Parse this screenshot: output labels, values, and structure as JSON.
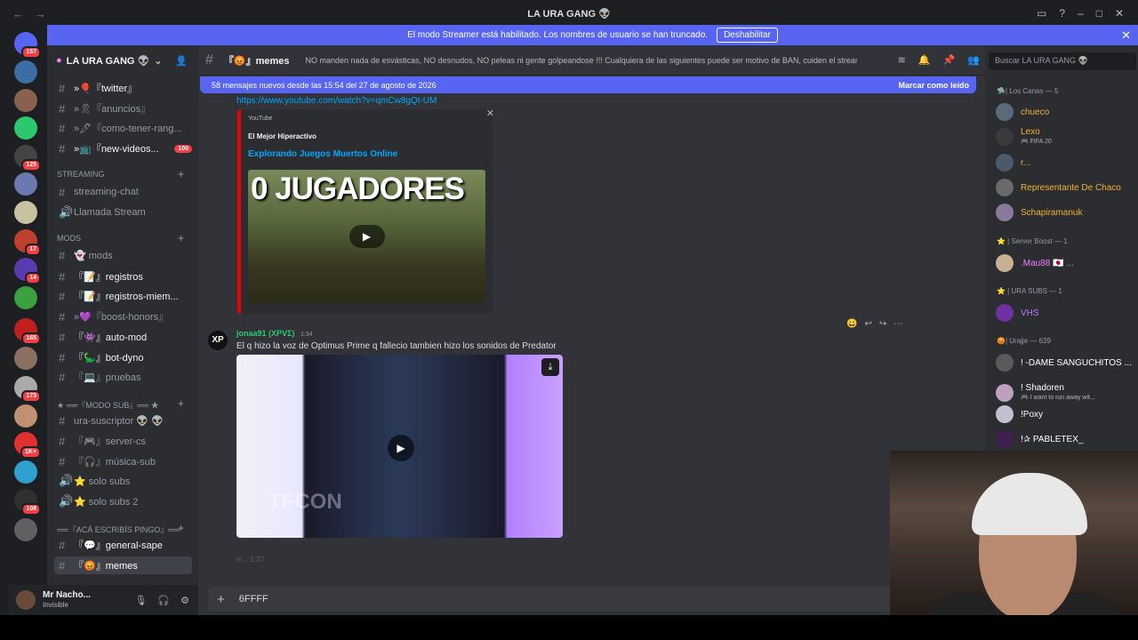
{
  "window": {
    "title": "LA URA GANG 👽"
  },
  "banner": {
    "text": "El modo Streamer está habilitado. Los nombres de usuario se han truncado.",
    "button": "Deshabilitar"
  },
  "servers": [
    {
      "badge": "157",
      "color": "#5865f2"
    },
    {
      "badge": "",
      "color": "#3a6ea5"
    },
    {
      "badge": "",
      "color": "#8a6050"
    },
    {
      "badge": "",
      "color": "#2dc770"
    },
    {
      "badge": "125",
      "color": "#444"
    },
    {
      "badge": "",
      "color": "#6a7ab0"
    },
    {
      "badge": "",
      "color": "#c9c2a0"
    },
    {
      "badge": "17",
      "color": "#c04030"
    },
    {
      "badge": "14",
      "color": "#5a3ab0"
    },
    {
      "badge": "",
      "color": "#3aa040"
    },
    {
      "badge": "165",
      "color": "#c02020"
    },
    {
      "badge": "",
      "color": "#8a7060"
    },
    {
      "badge": "173",
      "color": "#aaaaaa"
    },
    {
      "badge": "",
      "color": "#c09070"
    },
    {
      "badge": "1K+",
      "color": "#e03030"
    },
    {
      "badge": "",
      "color": "#30a0d0"
    },
    {
      "badge": "108",
      "color": "#303030"
    },
    {
      "badge": "",
      "color": "#606060"
    }
  ],
  "guild": {
    "name": "LA URA GANG 👽"
  },
  "channels": [
    {
      "name": "»🎈『twitter』",
      "unread": true,
      "badge": ""
    },
    {
      "name": "»🎗『anuncios』",
      "unread": false,
      "badge": ""
    },
    {
      "name": "»🖊『como-tener-rang...",
      "unread": false,
      "badge": ""
    },
    {
      "name": "»📺『new-videos...",
      "unread": true,
      "badge": "100"
    },
    {
      "name": "streaming-chat",
      "unread": false,
      "badge": ""
    },
    {
      "name": "Llamada Stream",
      "unread": false,
      "badge": ""
    },
    {
      "name": "👻 mods",
      "unread": false,
      "badge": ""
    },
    {
      "name": "『📝』registros",
      "unread": true,
      "badge": ""
    },
    {
      "name": "『📝』registros-miem...",
      "unread": true,
      "badge": ""
    },
    {
      "name": "»💜『boost-honors』",
      "unread": false,
      "badge": ""
    },
    {
      "name": "『👾』auto-mod",
      "unread": true,
      "badge": ""
    },
    {
      "name": "『🦕』bot-dyno",
      "unread": true,
      "badge": ""
    },
    {
      "name": "『💻』pruebas",
      "unread": false,
      "badge": ""
    },
    {
      "name": "ura-suscriptor 👽 👽",
      "unread": false,
      "badge": ""
    },
    {
      "name": "『🎮』server-cs",
      "unread": false,
      "badge": ""
    },
    {
      "name": "『🎧』música-sub",
      "unread": false,
      "badge": ""
    },
    {
      "name": "⭐ solo subs",
      "unread": false,
      "badge": ""
    },
    {
      "name": "⭐ solo subs 2",
      "unread": false,
      "badge": ""
    },
    {
      "name": "『💬』general-sape",
      "unread": true,
      "badge": ""
    },
    {
      "name": "『😡』memes",
      "unread": true,
      "badge": ""
    }
  ],
  "categories": [
    "STREAMING",
    "mods",
    "★ ══『MODO SUB』══ ★",
    "══『acá escribís pingo』══"
  ],
  "user": {
    "name": "Mr Nacho...",
    "status": "Invisible"
  },
  "header": {
    "channel": "『😡』memes",
    "topic": "NO manden nada de esvásticas, NO desnudos, NO peleas ni gente golpeandose !!! Cualquiera de las siguientes puede ser motivo de BAN, cuiden el stream!"
  },
  "new_messages": {
    "text": "58 mensajes nuevos desde las 15:54 del 27 de agosto de 2026",
    "action": "Marcar como leído"
  },
  "link": "https://www.youtube.com/watch?v=qmCw8gQt-UM",
  "embed": {
    "provider": "YouTube",
    "author": "El Mejor Hiperactivo",
    "title": "Explorando Juegos Muertos Online",
    "thumb_text": "0 JUGADORES"
  },
  "message": {
    "author": "jonaa91 (XPVΣ)",
    "time": "1:34",
    "text": "El q hizo la voz de Optimus Prime q fallecio tambien hizo los sonidos de Predator",
    "watermark": "TFCON"
  },
  "faded_text": "m...  1:37",
  "composer": {
    "value": "6FFFF"
  },
  "members": {
    "search": "Buscar LA URA GANG 👽",
    "groups": [
      {
        "title": "🛸| Los Canas — 5",
        "items": [
          {
            "name": "chueco",
            "activity": "",
            "color": "#f0b232"
          },
          {
            "name": "Lexo",
            "activity": "🎮 FIFA 20",
            "color": "#f0b232"
          },
          {
            "name": "r...",
            "activity": "",
            "color": "#f0b232"
          },
          {
            "name": "Representante De Chaco",
            "activity": "",
            "color": "#f0b232"
          },
          {
            "name": "Schapiramanuk",
            "activity": "",
            "color": "#f0b232"
          }
        ]
      },
      {
        "title": "⭐ | Server Boost — 1",
        "items": [
          {
            "name": ".Mau88 🇯🇵 ...",
            "activity": "",
            "color": "#f47fff"
          }
        ]
      },
      {
        "title": "⭐ | URA SUBS — 1",
        "items": [
          {
            "name": "VHS",
            "activity": "",
            "color": "#c27cff"
          }
        ]
      },
      {
        "title": "😡| Urajje — 639",
        "items": [
          {
            "name": "! -DAME SANGUCHITOS ...",
            "activity": "",
            "color": "#ffffff"
          },
          {
            "name": "! Shadoren",
            "activity": "🎮 I want to run away wit...",
            "color": "#ffffff"
          },
          {
            "name": "!Poxy",
            "activity": "",
            "color": "#ffffff"
          },
          {
            "name": "!✰ PABLETEX_",
            "activity": "",
            "color": "#ffffff"
          }
        ]
      }
    ]
  }
}
